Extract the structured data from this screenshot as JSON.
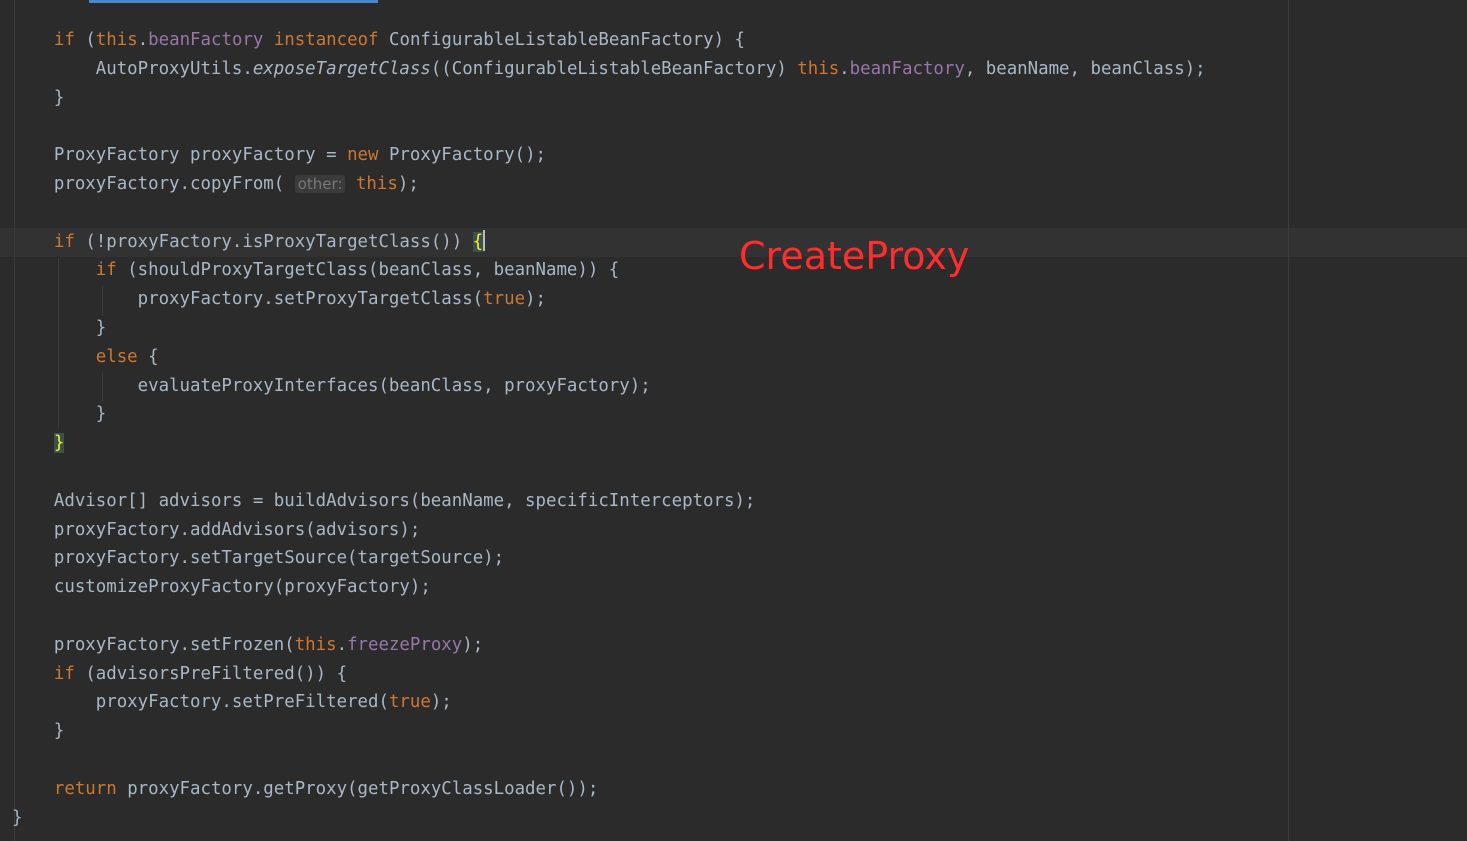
{
  "editor": {
    "annotation": "CreateProxy",
    "tokens": {
      "if": "if",
      "this": "this",
      "beanFactory": "beanFactory",
      "instanceof": "instanceof",
      "new": "new",
      "true": "true",
      "else": "else",
      "return": "return",
      "freezeProxy": "freezeProxy",
      "exposeTargetClass": "exposeTargetClass",
      "param_hint_other": "other:"
    },
    "lines": {
      "l1_a": " (",
      "l1_b": ".",
      "l1_c": " ",
      "l1_d": " ConfigurableListableBeanFactory) {",
      "l2_a": "AutoProxyUtils.",
      "l2_b": "((ConfigurableListableBeanFactory) ",
      "l2_c": ".",
      "l2_d": ", beanName, beanClass);",
      "l3": "}",
      "l5_a": "ProxyFactory proxyFactory = ",
      "l5_b": " ProxyFactory();",
      "l6_a": "proxyFactory.copyFrom( ",
      "l6_b": " ",
      "l6_c": ");",
      "l8_a": " (!proxyFactory.isProxyTargetClass()) ",
      "l8_brace": "{",
      "l9_a": " (shouldProxyTargetClass(beanClass, beanName)) {",
      "l10_a": "proxyFactory.setProxyTargetClass(",
      "l10_b": ");",
      "l11": "}",
      "l12_b": " {",
      "l13": "evaluateProxyInterfaces(beanClass, proxyFactory);",
      "l14": "}",
      "l15_brace": "}",
      "l17": "Advisor[] advisors = buildAdvisors(beanName, specificInterceptors);",
      "l18": "proxyFactory.addAdvisors(advisors);",
      "l19": "proxyFactory.setTargetSource(targetSource);",
      "l20": "customizeProxyFactory(proxyFactory);",
      "l22_a": "proxyFactory.setFrozen(",
      "l22_b": ".",
      "l22_c": ");",
      "l23_a": " (advisorsPreFiltered()) {",
      "l24_a": "proxyFactory.setPreFiltered(",
      "l24_b": ");",
      "l25": "}",
      "l27_b": " proxyFactory.getProxy(getProxyClassLoader());",
      "l28": "}"
    }
  }
}
